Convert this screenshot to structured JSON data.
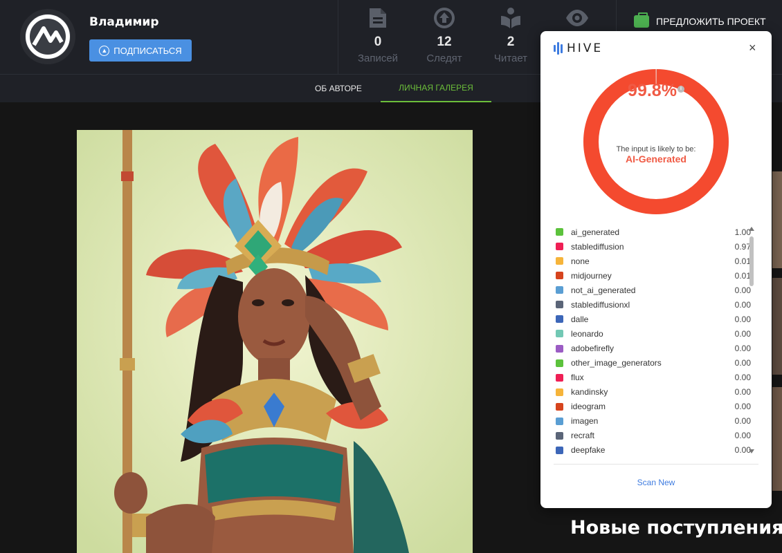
{
  "header": {
    "username": "Владимир",
    "subscribe_label": "ПОДПИСАТЬСЯ",
    "propose_label": "ПРЕДЛОЖИТЬ ПРОЕКТ",
    "stats": [
      {
        "icon": "document-icon",
        "value": "0",
        "label": "Записей"
      },
      {
        "icon": "arrow-up-circle-icon",
        "value": "12",
        "label": "Следят"
      },
      {
        "icon": "reader-icon",
        "value": "2",
        "label": "Читает"
      },
      {
        "icon": "eye-icon",
        "value": "",
        "label": ""
      }
    ]
  },
  "tabs": [
    {
      "label": "ОБ АВТОРЕ",
      "active": false
    },
    {
      "label": "ЛИЧНАЯ ГАЛЕРЕЯ",
      "active": true
    }
  ],
  "sidebar": {
    "new_arrivals": "Новые поступления"
  },
  "hive": {
    "brand": "HIVE",
    "close": "×",
    "percentage": "99.8%",
    "likely_text": "The input is likely to be:",
    "verdict": "AI-Generated",
    "score": 0.998,
    "accent": "#f44a2f",
    "scan_label": "Scan New",
    "classes": [
      {
        "name": "ai_generated",
        "value": "1.00",
        "color": "#5cc23c"
      },
      {
        "name": "stablediffusion",
        "value": "0.97",
        "color": "#ef1f55"
      },
      {
        "name": "none",
        "value": "0.01",
        "color": "#f6b43a"
      },
      {
        "name": "midjourney",
        "value": "0.01",
        "color": "#d6441e"
      },
      {
        "name": "not_ai_generated",
        "value": "0.00",
        "color": "#5a9ed3"
      },
      {
        "name": "stablediffusionxl",
        "value": "0.00",
        "color": "#5b6578"
      },
      {
        "name": "dalle",
        "value": "0.00",
        "color": "#3c66b8"
      },
      {
        "name": "leonardo",
        "value": "0.00",
        "color": "#72c8b4"
      },
      {
        "name": "adobefirefly",
        "value": "0.00",
        "color": "#9b5cc4"
      },
      {
        "name": "other_image_generators",
        "value": "0.00",
        "color": "#5cc23c"
      },
      {
        "name": "flux",
        "value": "0.00",
        "color": "#ef1f55"
      },
      {
        "name": "kandinsky",
        "value": "0.00",
        "color": "#f6b43a"
      },
      {
        "name": "ideogram",
        "value": "0.00",
        "color": "#d6441e"
      },
      {
        "name": "imagen",
        "value": "0.00",
        "color": "#5a9ed3"
      },
      {
        "name": "recraft",
        "value": "0.00",
        "color": "#5b6578"
      },
      {
        "name": "deepfake",
        "value": "0.00",
        "color": "#3c66b8"
      }
    ]
  }
}
